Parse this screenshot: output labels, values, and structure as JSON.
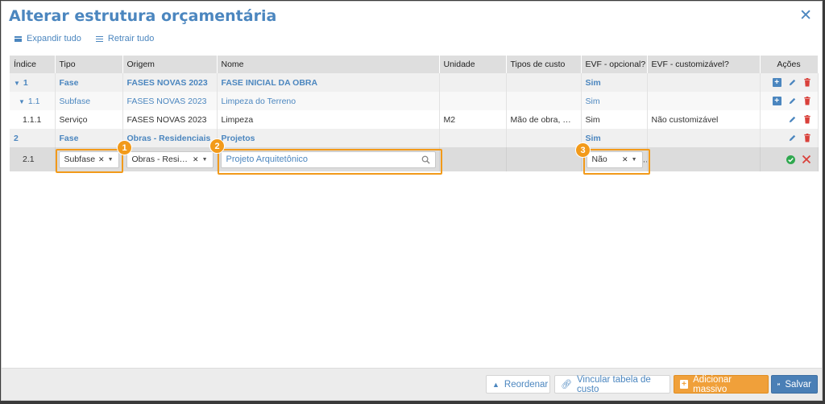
{
  "dialog": {
    "title": "Alterar estrutura orçamentária"
  },
  "toolbar": {
    "expand_label": "Expandir tudo",
    "collapse_label": "Retrair tudo"
  },
  "columns": [
    "Índice",
    "Tipo",
    "Origem",
    "Nome",
    "Unidade",
    "Tipos de custo",
    "EVF - opcional?",
    "EVF - customizável?",
    "Ações"
  ],
  "rows": [
    {
      "indice": "1",
      "tipo": "Fase",
      "origem": "FASES NOVAS 2023",
      "nome": "FASE INICIAL DA OBRA",
      "unidade": "",
      "tipos_custo": "",
      "evf_opcional": "Sim",
      "evf_custom": ""
    },
    {
      "indice": "1.1",
      "tipo": "Subfase",
      "origem": "FASES NOVAS 2023",
      "nome": "Limpeza do Terreno",
      "unidade": "",
      "tipos_custo": "",
      "evf_opcional": "Sim",
      "evf_custom": ""
    },
    {
      "indice": "1.1.1",
      "tipo": "Serviço",
      "origem": "FASES NOVAS 2023",
      "nome": "Limpeza",
      "unidade": "M2",
      "tipos_custo": "Mão de obra, M...",
      "evf_opcional": "Sim",
      "evf_custom": "Não customizável"
    },
    {
      "indice": "2",
      "tipo": "Fase",
      "origem": "Obras - Residenciais",
      "nome": "Projetos",
      "unidade": "",
      "tipos_custo": "",
      "evf_opcional": "Sim",
      "evf_custom": ""
    }
  ],
  "edit_row": {
    "indice": "2.1",
    "tipo_value": "Subfase",
    "origem_value": "Obras - Reside...",
    "nome_value": "Projeto Arquitetônico",
    "evf_value": "Não"
  },
  "badges": {
    "one": "1",
    "two": "2",
    "three": "3"
  },
  "footer": {
    "reorder_label": "Reordenar",
    "link_label": "Vincular tabela de custo",
    "bulk_label": "Adicionar massivo",
    "save_label": "Salvar"
  },
  "colors": {
    "accent": "#4b86bf",
    "highlight": "#f29a1a",
    "danger": "#d9403a",
    "success": "#2fa84f"
  }
}
